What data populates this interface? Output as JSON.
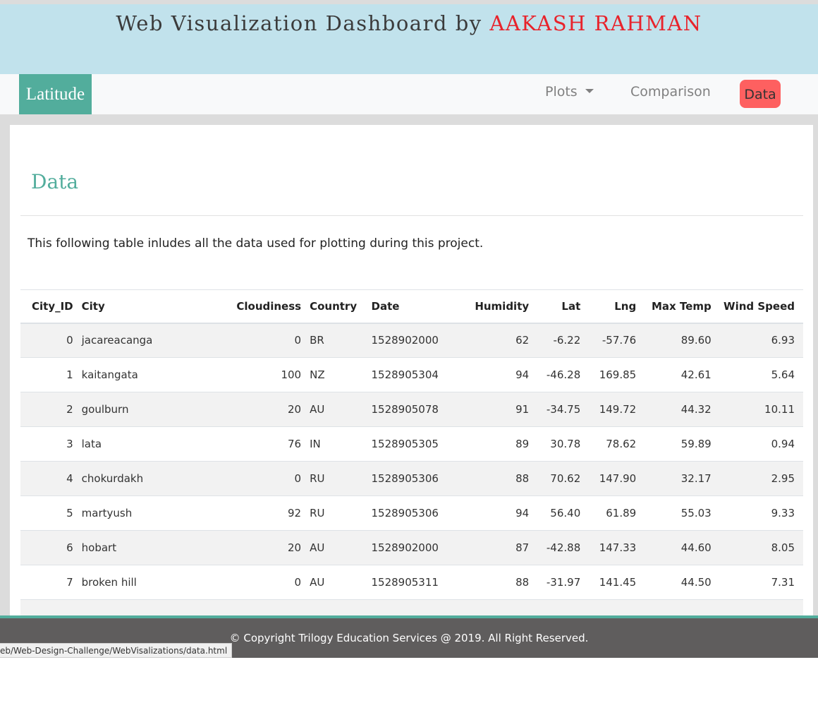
{
  "banner": {
    "title_prefix": "Web Visualization Dashboard by ",
    "author": "AAKASH RAHMAN"
  },
  "navbar": {
    "brand": "Latitude",
    "plots_label": "Plots",
    "comparison_label": "Comparison",
    "data_label": "Data"
  },
  "card": {
    "title": "Data",
    "description": "This following table inludes all the data used for plotting during this project."
  },
  "table": {
    "headers": [
      "City_ID",
      "City",
      "Cloudiness",
      "Country",
      "Date",
      "Humidity",
      "Lat",
      "Lng",
      "Max Temp",
      "Wind Speed"
    ],
    "rows": [
      [
        "0",
        "jacareacanga",
        "0",
        "BR",
        "1528902000",
        "62",
        "-6.22",
        "-57.76",
        "89.60",
        "6.93"
      ],
      [
        "1",
        "kaitangata",
        "100",
        "NZ",
        "1528905304",
        "94",
        "-46.28",
        "169.85",
        "42.61",
        "5.64"
      ],
      [
        "2",
        "goulburn",
        "20",
        "AU",
        "1528905078",
        "91",
        "-34.75",
        "149.72",
        "44.32",
        "10.11"
      ],
      [
        "3",
        "lata",
        "76",
        "IN",
        "1528905305",
        "89",
        "30.78",
        "78.62",
        "59.89",
        "0.94"
      ],
      [
        "4",
        "chokurdakh",
        "0",
        "RU",
        "1528905306",
        "88",
        "70.62",
        "147.90",
        "32.17",
        "2.95"
      ],
      [
        "5",
        "martyush",
        "92",
        "RU",
        "1528905306",
        "94",
        "56.40",
        "61.89",
        "55.03",
        "9.33"
      ],
      [
        "6",
        "hobart",
        "20",
        "AU",
        "1528902000",
        "87",
        "-42.88",
        "147.33",
        "44.60",
        "8.05"
      ],
      [
        "7",
        "broken hill",
        "0",
        "AU",
        "1528905311",
        "88",
        "-31.97",
        "141.45",
        "44.50",
        "7.31"
      ],
      [
        "",
        "",
        "",
        "",
        "",
        "",
        "",
        "",
        "",
        ""
      ]
    ]
  },
  "footer": {
    "text": "© Copyright Trilogy Education Services @ 2019. All Right Reserved."
  },
  "status_bar": {
    "url": "eb/Web-Design-Challenge/WebVisalizations/data.html"
  },
  "colors": {
    "accent": "#52ad9c",
    "banner_bg": "#c1e2ec",
    "active_nav": "#fe6060",
    "footer_bg": "#5f5d5d",
    "author": "#e8232b"
  }
}
